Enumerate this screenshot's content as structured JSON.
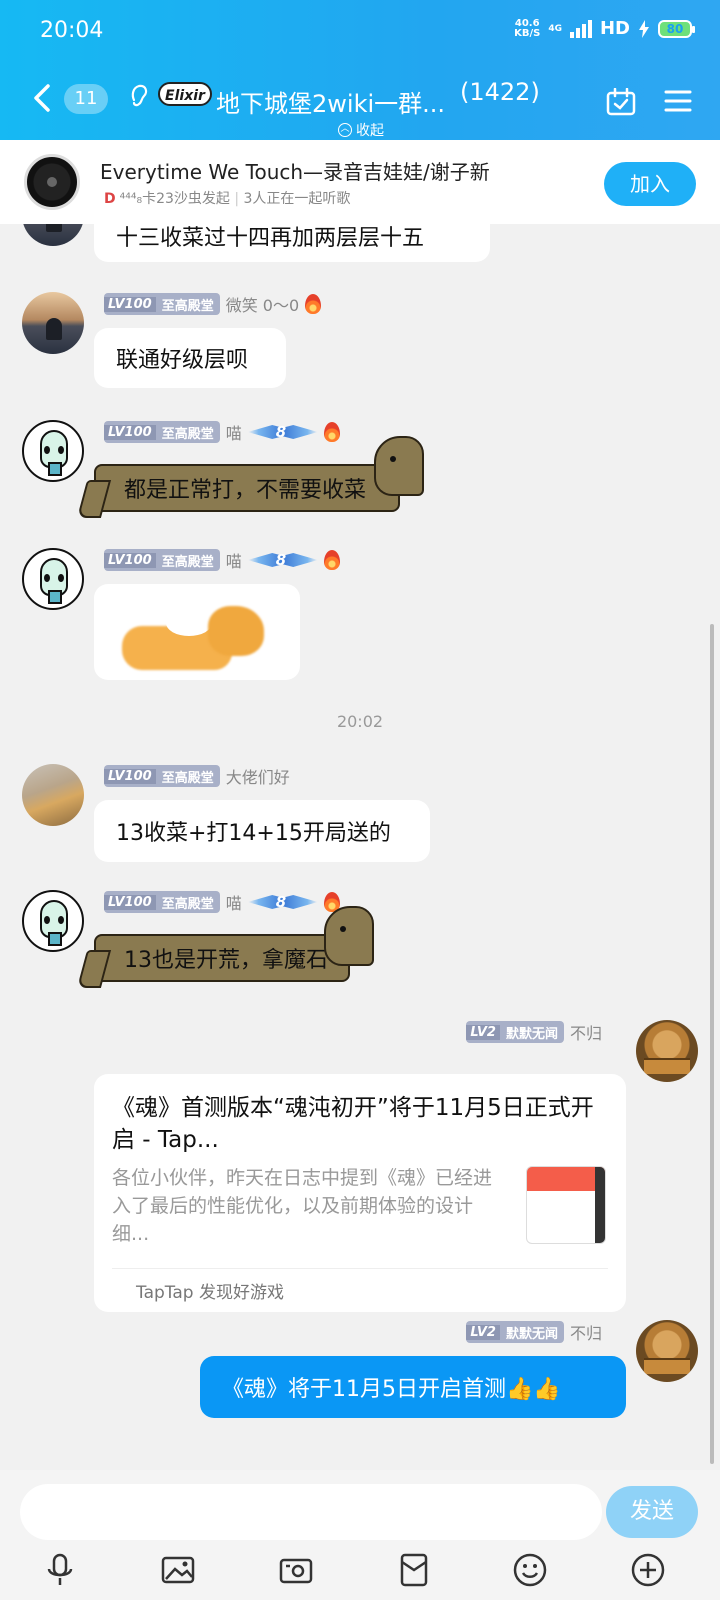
{
  "status": {
    "time": "20:04",
    "speed_top": "40.6",
    "speed_bottom": "KB/S",
    "network": "4G",
    "hd": "HD",
    "battery": "80"
  },
  "header": {
    "unread": "11",
    "badge": "Elixir",
    "title": "地下城堡2wiki一群...",
    "count": "(1422)",
    "collapse": "收起"
  },
  "music": {
    "song": "Everytime We Touch—录音吉娃娃/谢子新",
    "host_mark": "D",
    "host": "⁴⁴⁴₈卡23沙虫发起",
    "listeners": "3人正在一起听歌",
    "join": "加入"
  },
  "messages": {
    "m0": {
      "text": "十三收菜过十四再加两层层十五"
    },
    "m1": {
      "lv": "LV100",
      "tag": "至高殿堂",
      "name": "微笑  0～0",
      "text": "联通好级层呗"
    },
    "m2": {
      "lv": "LV100",
      "tag": "至高殿堂",
      "name": "喵",
      "wing": "8",
      "text": "都是正常打，不需要收菜"
    },
    "m3": {
      "lv": "LV100",
      "tag": "至高殿堂",
      "name": "喵",
      "wing": "8"
    },
    "time": "20:02",
    "m4": {
      "lv": "LV100",
      "tag": "至高殿堂",
      "name": "大佬们好",
      "text": "13收菜+打14+15开局送的"
    },
    "m5": {
      "lv": "LV100",
      "tag": "至高殿堂",
      "name": "喵",
      "wing": "8",
      "text": "13也是开荒，拿魔石"
    },
    "m6": {
      "lv": "LV2",
      "tag": "默默无闻",
      "name": "不归",
      "card_title": "《魂》首测版本“魂沌初开”将于11月5日正式开启 - Tap...",
      "card_desc": "各位小伙伴，昨天在日志中提到《魂》已经进入了最后的性能优化，以及前期体验的设计细...",
      "card_source": "TapTap 发现好游戏"
    },
    "m7": {
      "lv": "LV2",
      "tag": "默默无闻",
      "name": "不归",
      "text": "《魂》将于11月5日开启首测👍👍"
    }
  },
  "input": {
    "send": "发送"
  },
  "icons": [
    "back-icon",
    "ear-icon",
    "calendar-check-icon",
    "menu-icon",
    "mic-icon",
    "image-icon",
    "camera-icon",
    "red-packet-icon",
    "emoji-icon",
    "plus-icon",
    "flame-icon",
    "play-icon"
  ]
}
